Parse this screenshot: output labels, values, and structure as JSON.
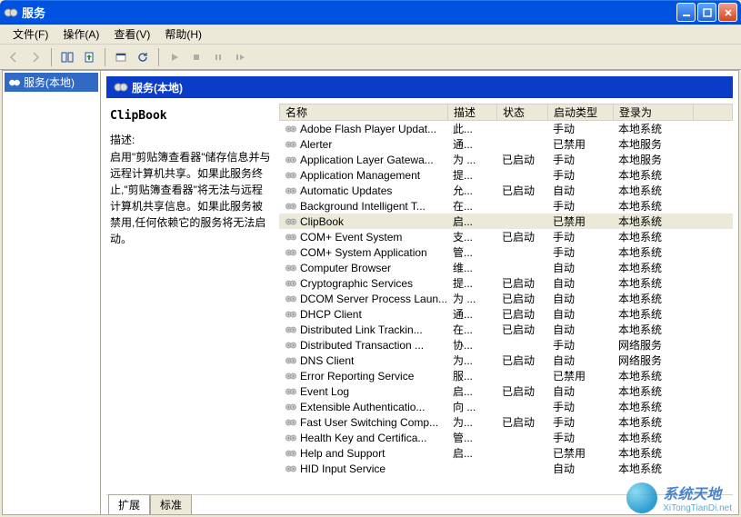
{
  "window": {
    "title": "服务"
  },
  "menu": {
    "file": "文件(F)",
    "action": "操作(A)",
    "view": "查看(V)",
    "help": "帮助(H)"
  },
  "tree": {
    "root": "服务(本地)"
  },
  "header": {
    "title": "服务(本地)"
  },
  "detail": {
    "name": "ClipBook",
    "desc_label": "描述:",
    "desc": "启用\"剪贴簿查看器\"储存信息并与远程计算机共享。如果此服务终止,\"剪贴簿查看器\"将无法与远程计算机共享信息。如果此服务被禁用,任何依赖它的服务将无法启动。"
  },
  "columns": {
    "name": "名称",
    "desc": "描述",
    "status": "状态",
    "startup": "启动类型",
    "logon": "登录为"
  },
  "tabs": {
    "ext": "扩展",
    "std": "标准"
  },
  "watermark": {
    "main": "系统天地",
    "sub": "XiTongTianDi.net"
  },
  "services": [
    {
      "name": "Adobe Flash Player Updat...",
      "desc": "此...",
      "status": "",
      "start": "手动",
      "logon": "本地系统"
    },
    {
      "name": "Alerter",
      "desc": "通...",
      "status": "",
      "start": "已禁用",
      "logon": "本地服务"
    },
    {
      "name": "Application Layer Gatewa...",
      "desc": "为 ...",
      "status": "已启动",
      "start": "手动",
      "logon": "本地服务"
    },
    {
      "name": "Application Management",
      "desc": "提...",
      "status": "",
      "start": "手动",
      "logon": "本地系统"
    },
    {
      "name": "Automatic Updates",
      "desc": "允...",
      "status": "已启动",
      "start": "自动",
      "logon": "本地系统"
    },
    {
      "name": "Background Intelligent T...",
      "desc": "在...",
      "status": "",
      "start": "手动",
      "logon": "本地系统"
    },
    {
      "name": "ClipBook",
      "desc": "启...",
      "status": "",
      "start": "已禁用",
      "logon": "本地系统",
      "selected": true
    },
    {
      "name": "COM+ Event System",
      "desc": "支...",
      "status": "已启动",
      "start": "手动",
      "logon": "本地系统"
    },
    {
      "name": "COM+ System Application",
      "desc": "管...",
      "status": "",
      "start": "手动",
      "logon": "本地系统"
    },
    {
      "name": "Computer Browser",
      "desc": "维...",
      "status": "",
      "start": "自动",
      "logon": "本地系统"
    },
    {
      "name": "Cryptographic Services",
      "desc": "提...",
      "status": "已启动",
      "start": "自动",
      "logon": "本地系统"
    },
    {
      "name": "DCOM Server Process Laun...",
      "desc": "为 ...",
      "status": "已启动",
      "start": "自动",
      "logon": "本地系统"
    },
    {
      "name": "DHCP Client",
      "desc": "通...",
      "status": "已启动",
      "start": "自动",
      "logon": "本地系统"
    },
    {
      "name": "Distributed Link Trackin...",
      "desc": "在...",
      "status": "已启动",
      "start": "自动",
      "logon": "本地系统"
    },
    {
      "name": "Distributed Transaction ...",
      "desc": "协...",
      "status": "",
      "start": "手动",
      "logon": "网络服务"
    },
    {
      "name": "DNS Client",
      "desc": "为...",
      "status": "已启动",
      "start": "自动",
      "logon": "网络服务"
    },
    {
      "name": "Error Reporting Service",
      "desc": "服...",
      "status": "",
      "start": "已禁用",
      "logon": "本地系统"
    },
    {
      "name": "Event Log",
      "desc": "启...",
      "status": "已启动",
      "start": "自动",
      "logon": "本地系统"
    },
    {
      "name": "Extensible Authenticatio...",
      "desc": "向 ...",
      "status": "",
      "start": "手动",
      "logon": "本地系统"
    },
    {
      "name": "Fast User Switching Comp...",
      "desc": "为...",
      "status": "已启动",
      "start": "手动",
      "logon": "本地系统"
    },
    {
      "name": "Health Key and Certifica...",
      "desc": "管...",
      "status": "",
      "start": "手动",
      "logon": "本地系统"
    },
    {
      "name": "Help and Support",
      "desc": "启...",
      "status": "",
      "start": "已禁用",
      "logon": "本地系统"
    },
    {
      "name": "HID Input Service",
      "desc": "",
      "status": "",
      "start": "自动",
      "logon": "本地系统"
    }
  ]
}
